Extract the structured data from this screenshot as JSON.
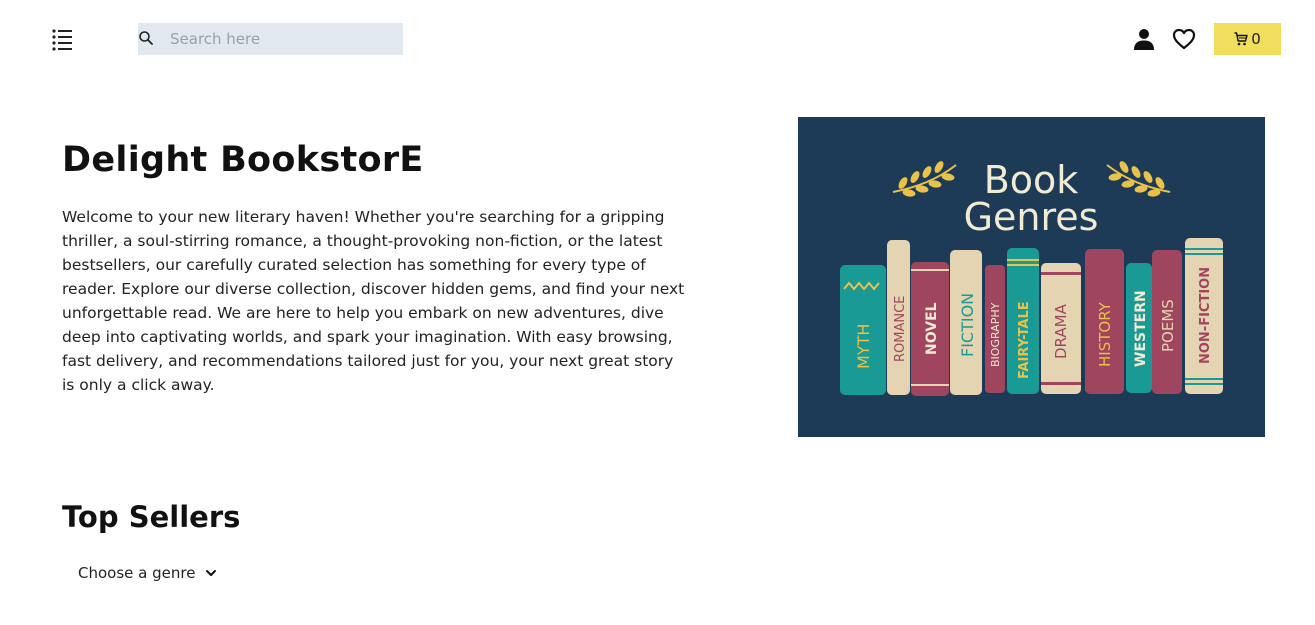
{
  "header": {
    "menu_icon": "list-menu-icon",
    "search": {
      "placeholder": "Search here",
      "value": "",
      "icon": "search-icon"
    },
    "user_icon": "user-icon",
    "wishlist_icon": "heart-icon",
    "cart": {
      "icon": "cart-icon",
      "count": "0",
      "color": "#f1de5c"
    }
  },
  "hero": {
    "title": "Delight BookstorE",
    "description": "Welcome to your new literary haven! Whether you're searching for a gripping thriller, a soul-stirring romance, a thought-provoking non-fiction, or the latest bestsellers, our carefully curated selection has something for every type of reader. Explore our diverse collection, discover hidden gems, and find your next unforgettable read. We are here to help you embark on new adventures, dive deep into captivating worlds, and spark your imagination. With easy browsing, fast delivery, and recommendations tailored just for you, your next great story is only a click away.",
    "image": {
      "background": "#1d3a57",
      "heading_line1": "Book",
      "heading_line2": "Genres",
      "books": [
        "MYTH",
        "ROMANCE",
        "NOVEL",
        "FICTION",
        "BIOGRAPHY",
        "FAIRY-TALE",
        "DRAMA",
        "HISTORY",
        "WESTERN",
        "POEMS",
        "NON-FICTION"
      ]
    }
  },
  "top_sellers": {
    "title": "Top Sellers",
    "genre_select": {
      "selected": "Choose a genre",
      "icon": "chevron-down-icon"
    }
  }
}
